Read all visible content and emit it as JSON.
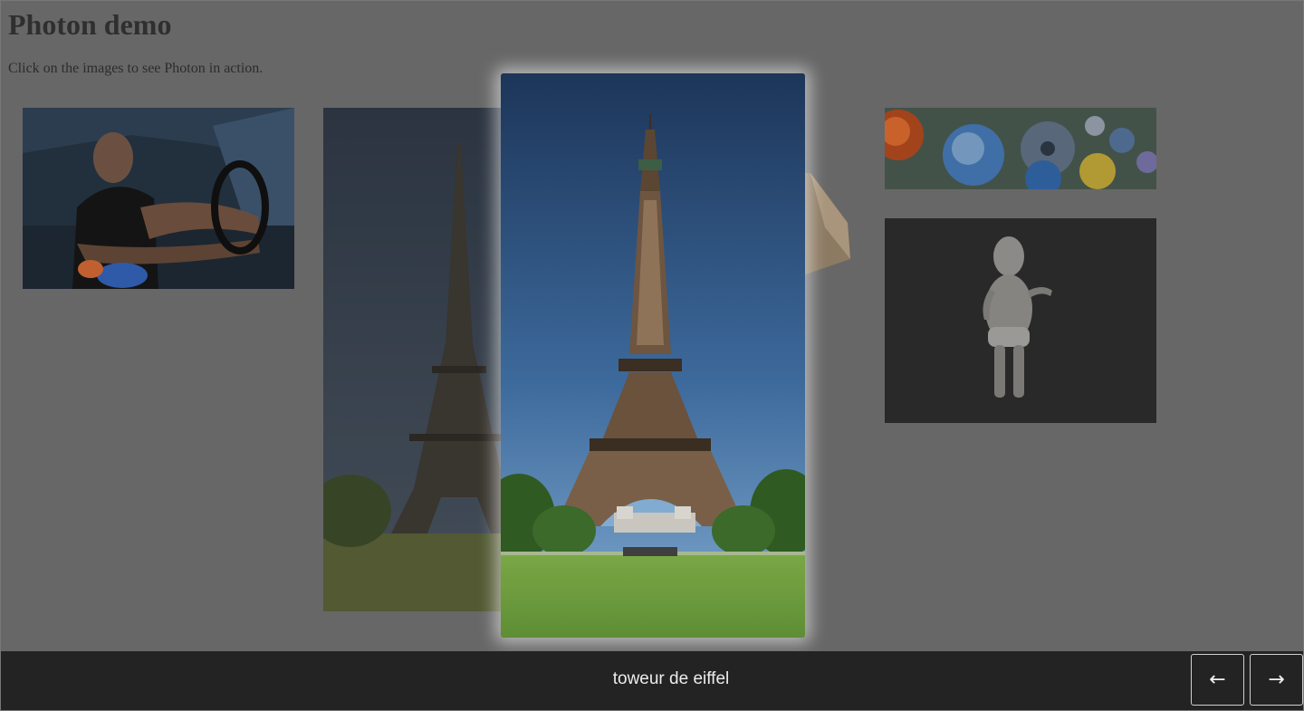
{
  "page": {
    "title": "Photon demo",
    "subtitle": "Click on the images to see Photon in action."
  },
  "gallery": {
    "items": [
      {
        "name": "driver-photo"
      },
      {
        "name": "eiffel-tower-photo"
      },
      {
        "name": "planets-photo"
      },
      {
        "name": "baby-photo"
      }
    ]
  },
  "lightbox": {
    "caption": "toweur de eiffel",
    "prev_label": "←",
    "next_label": "→"
  },
  "colors": {
    "overlay": "#676767",
    "bottom_bar": "#232323",
    "caption_text": "#ececec",
    "sky_top": "#1d3559",
    "sky_bottom": "#7fa9cf",
    "grass": "#6e9c3e"
  }
}
